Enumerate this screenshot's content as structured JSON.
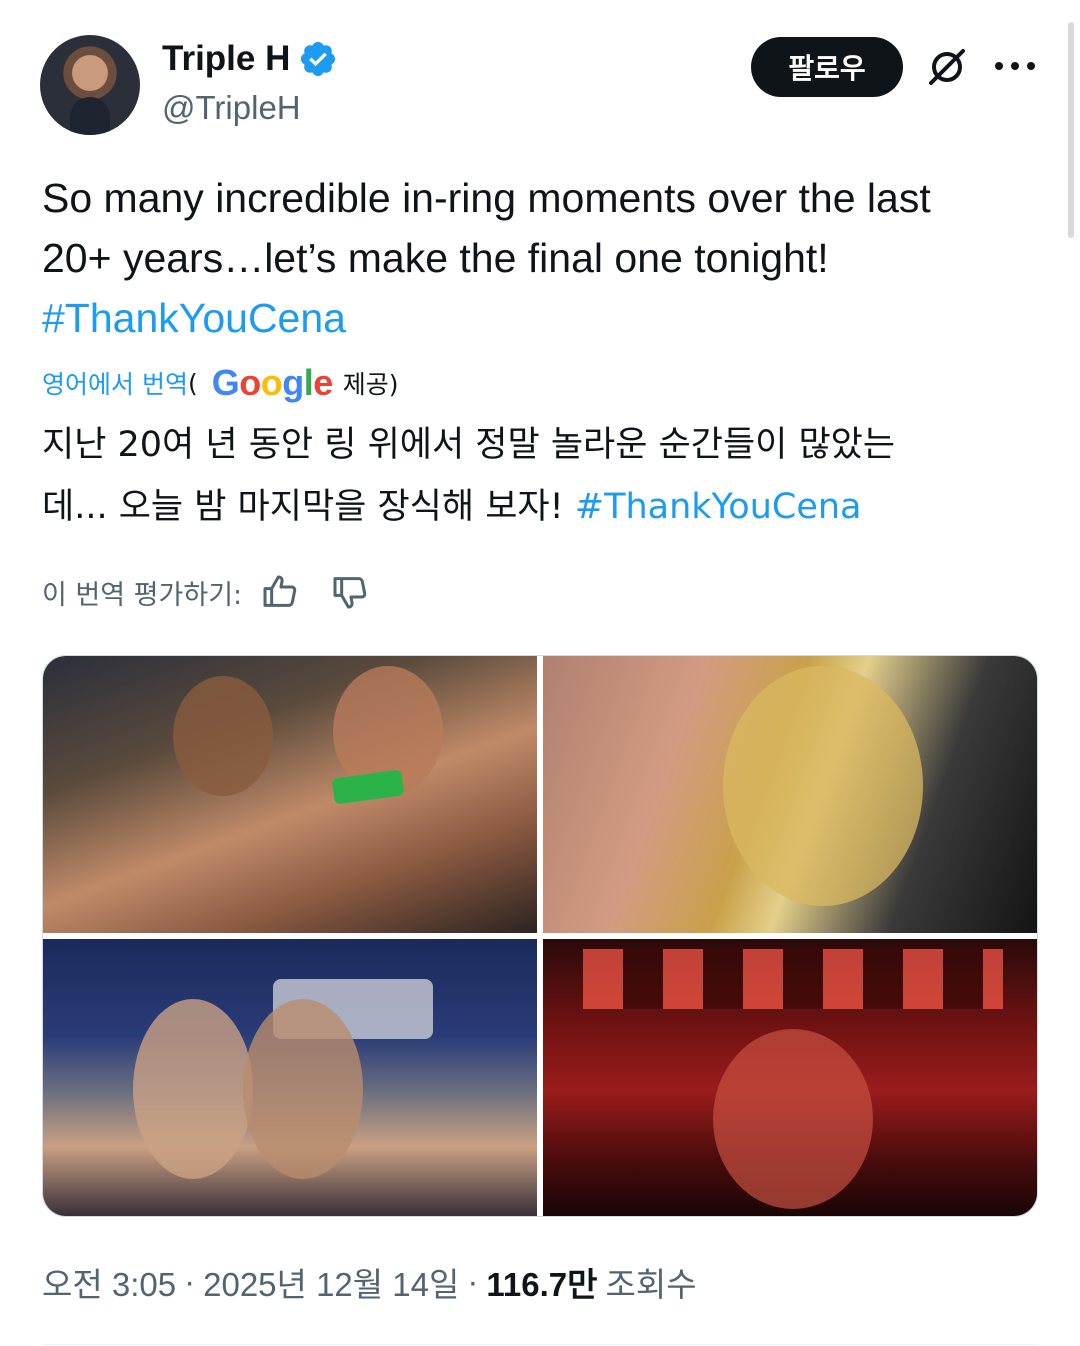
{
  "author": {
    "name": "Triple H",
    "handle": "@TripleH",
    "verified_color": "#1d9bf0"
  },
  "actions": {
    "follow_label": "팔로우",
    "grok_icon": "grok-icon",
    "more_icon": "more-icon"
  },
  "tweet": {
    "text_line1": "So many incredible in-ring moments over the last",
    "text_line2": "20+ years…let’s make the final one tonight!",
    "hashtag": "#ThankYouCena"
  },
  "translation": {
    "link_label": "영어에서 번역",
    "paren_open": "(",
    "provider_logo": "Google",
    "provider_suffix": "제공)",
    "text_line1": "지난 20여 년 동안 링 위에서 정말 놀라운 순간들이 많았는",
    "text_line2": "데... 오늘 밤 마지막을 장식해 보자! ",
    "hashtag": "#ThankYouCena",
    "rate_label": "이 번역 평가하기:"
  },
  "media": [
    {
      "label": "photo-1"
    },
    {
      "label": "photo-2"
    },
    {
      "label": "photo-3"
    },
    {
      "label": "photo-4"
    }
  ],
  "footer": {
    "time": "오전 3:05",
    "sep1": "·",
    "date": "2025년 12월 14일",
    "sep2": "·",
    "views": "116.7만",
    "views_label": "조회수"
  },
  "colors": {
    "link": "#1d9bf0",
    "secondary_text": "#536471",
    "primary_text": "#0f1419",
    "follow_bg": "#0f1419"
  }
}
